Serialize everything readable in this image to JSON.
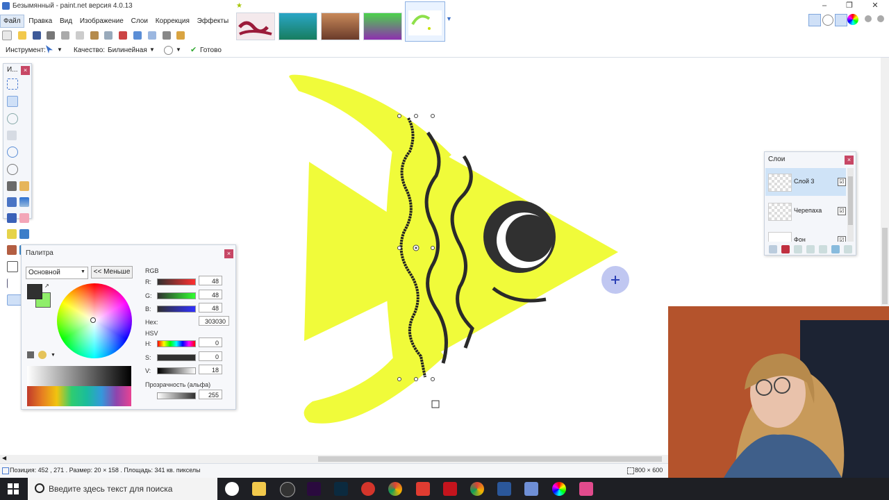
{
  "window": {
    "title": "Безымянный - paint.net версия 4.0.13"
  },
  "menu": [
    {
      "label": "Файл"
    },
    {
      "label": "Правка"
    },
    {
      "label": "Вид"
    },
    {
      "label": "Изображение"
    },
    {
      "label": "Слои"
    },
    {
      "label": "Коррекция"
    },
    {
      "label": "Эффекты"
    }
  ],
  "options_bar": {
    "tool_label": "Инструмент:",
    "quality_label": "Качество:",
    "quality_value": "Билинейная",
    "status": "Готово"
  },
  "tools_window": {
    "title": "И...",
    "close": "×"
  },
  "palette": {
    "title": "Палитра",
    "close": "×",
    "mode": "Основной",
    "less_button": "<< Меньше",
    "rgb_label": "RGB",
    "r_label": "R:",
    "r_value": "48",
    "g_label": "G:",
    "g_value": "48",
    "b_label": "B:",
    "b_value": "48",
    "hex_label": "Hex:",
    "hex_value": "303030",
    "hsv_label": "HSV",
    "h_label": "H:",
    "h_value": "0",
    "s_label": "S:",
    "s_value": "0",
    "v_label": "V:",
    "v_value": "18",
    "alpha_label": "Прозрачность (альфа)",
    "alpha_value": "255",
    "primary_color": "#303030",
    "secondary_color": "#90ee6a"
  },
  "layers": {
    "title": "Слои",
    "close": "×",
    "items": [
      {
        "name": "Слой 3",
        "checked": "☑"
      },
      {
        "name": "Черепаха",
        "checked": "☑"
      },
      {
        "name": "Фон",
        "checked": "☑"
      }
    ]
  },
  "status": {
    "info": "Позиция: 452 , 271 . Размер: 20 × 158 . Площадь: 341 кв. пикселы",
    "canvas_size": "800 × 600"
  },
  "taskbar": {
    "search_placeholder": "Введите здесь текст для поиска"
  },
  "colors": {
    "fish": "#f0fb3a",
    "stroke": "#2a2a2a",
    "accent": "#c74765"
  }
}
